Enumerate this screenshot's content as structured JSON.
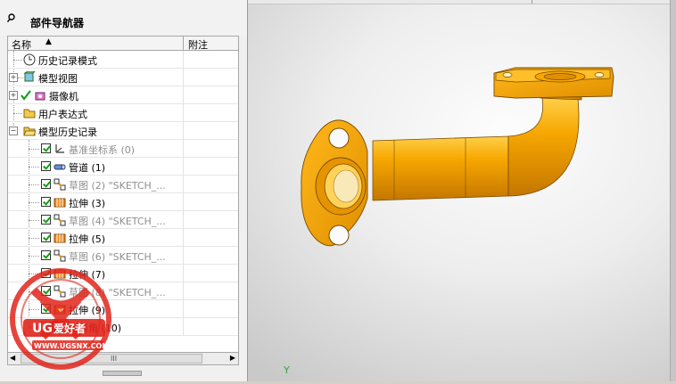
{
  "panel": {
    "title": "部件导航器",
    "columns": {
      "name": "名称",
      "note": "附注"
    }
  },
  "tree": [
    {
      "label": "历史记录模式",
      "icon": "clock-icon"
    },
    {
      "label": "模型视图",
      "icon": "model-views-icon"
    },
    {
      "label": "摄像机",
      "icon": "camera-icon"
    },
    {
      "label": "用户表达式",
      "icon": "folder-icon"
    },
    {
      "label": "模型历史记录",
      "icon": "folder-open-icon"
    },
    {
      "label": "基准坐标系 (0)",
      "icon": "datum-csys-icon"
    },
    {
      "label": "管道 (1)",
      "icon": "tube-icon"
    },
    {
      "label": "草图 (2) \"SKETCH_...",
      "icon": "sketch-icon"
    },
    {
      "label": "拉伸 (3)",
      "icon": "extrude-icon"
    },
    {
      "label": "草图 (4) \"SKETCH_...",
      "icon": "sketch-icon"
    },
    {
      "label": "拉伸 (5)",
      "icon": "extrude-icon"
    },
    {
      "label": "草图 (6) \"SKETCH_...",
      "icon": "sketch-icon"
    },
    {
      "label": "拉伸 (7)",
      "icon": "extrude-icon"
    },
    {
      "label": "草图 (8) \"SKETCH_...",
      "icon": "sketch-icon"
    },
    {
      "label": "拉伸 (9)",
      "icon": "extrude-icon"
    },
    {
      "label": "倒斜角 (10)",
      "icon": "chamfer-icon"
    }
  ],
  "viewport": {
    "axis_label": "Y"
  },
  "watermark": {
    "text": "UG爱好者",
    "url": "WWW.UGSNX.COM"
  },
  "colors": {
    "part": "#f5a300",
    "part_dark": "#c97a00",
    "check": "#1a9a1a"
  }
}
